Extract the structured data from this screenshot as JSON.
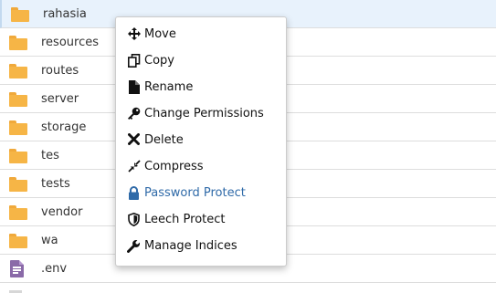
{
  "files": [
    {
      "name": "rahasia",
      "type": "folder",
      "selected": true,
      "icon": "folder-icon"
    },
    {
      "name": "resources",
      "type": "folder",
      "icon": "folder-icon"
    },
    {
      "name": "routes",
      "type": "folder",
      "icon": "folder-icon"
    },
    {
      "name": "server",
      "type": "folder",
      "icon": "folder-icon"
    },
    {
      "name": "storage",
      "type": "folder",
      "icon": "folder-icon"
    },
    {
      "name": "tes",
      "type": "folder",
      "icon": "folder-icon"
    },
    {
      "name": "tests",
      "type": "folder",
      "icon": "folder-icon"
    },
    {
      "name": "vendor",
      "type": "folder",
      "icon": "folder-icon"
    },
    {
      "name": "wa",
      "type": "folder",
      "icon": "folder-icon"
    },
    {
      "name": ".env",
      "type": "file",
      "icon": "text-file-icon"
    }
  ],
  "context_menu": {
    "items": [
      {
        "label": "Move",
        "icon": "move-icon"
      },
      {
        "label": "Copy",
        "icon": "copy-icon"
      },
      {
        "label": "Rename",
        "icon": "file-icon"
      },
      {
        "label": "Change Permissions",
        "icon": "key-icon"
      },
      {
        "label": "Delete",
        "icon": "close-icon"
      },
      {
        "label": "Compress",
        "icon": "compress-icon"
      },
      {
        "label": "Password Protect",
        "icon": "lock-icon",
        "highlighted": true
      },
      {
        "label": "Leech Protect",
        "icon": "shield-icon"
      },
      {
        "label": "Manage Indices",
        "icon": "wrench-icon"
      }
    ]
  },
  "colors": {
    "folder": "#f6b546",
    "file": "#8a6aa8",
    "selected_row": "#e8f2fc",
    "highlight_text": "#2f6aa8"
  }
}
